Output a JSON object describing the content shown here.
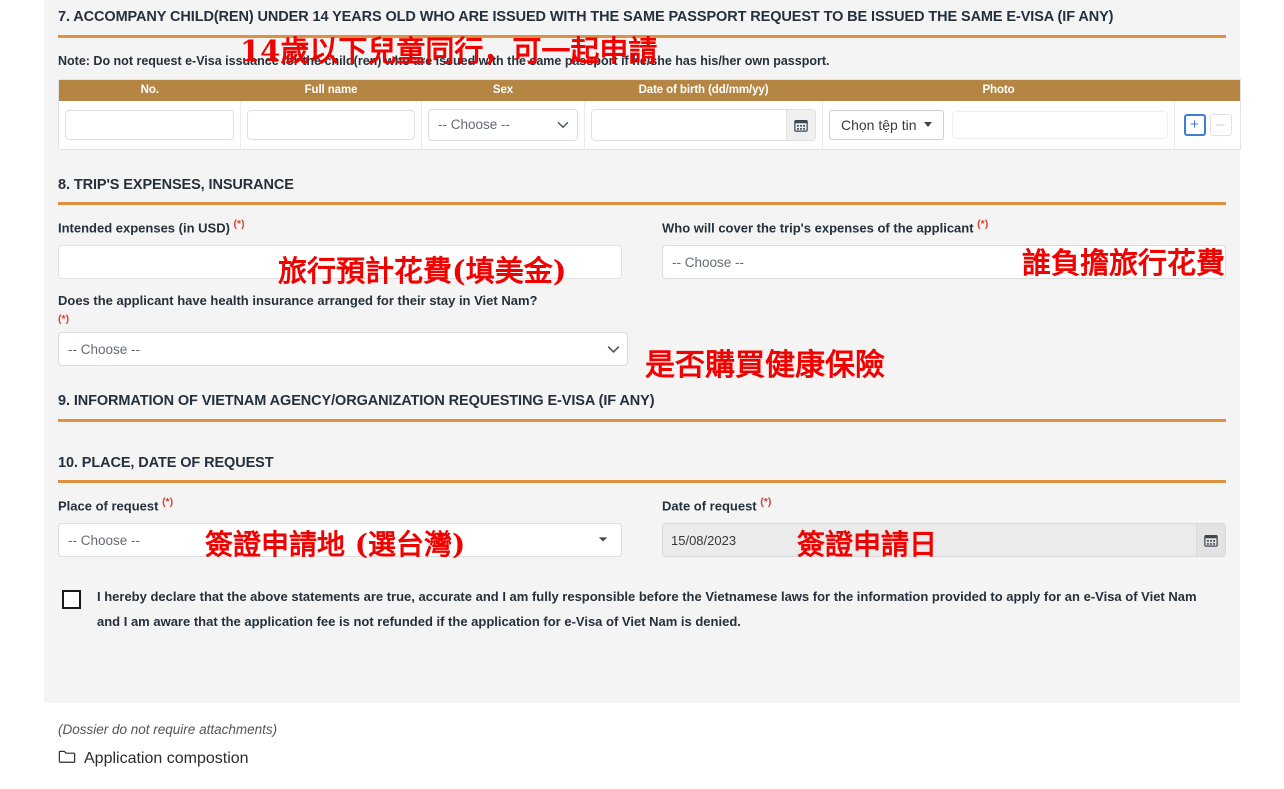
{
  "section7": {
    "title": "7. ACCOMPANY CHILD(REN) UNDER 14 YEARS OLD WHO ARE ISSUED WITH THE SAME PASSPORT REQUEST TO BE ISSUED THE SAME E-VISA (IF ANY)",
    "annotation": "14歲以下兒童同行，可一起申請",
    "note": "Note: Do not request e-Visa issuance for the child(ren) who are issued with the same passport if he/she has his/her own passport.",
    "table": {
      "headers": [
        "No.",
        "Full name",
        "Sex",
        "Date of birth (dd/mm/yy)",
        "Photo",
        ""
      ],
      "rows": [
        {
          "no": "",
          "full_name": "",
          "sex": "-- Choose --",
          "dob": "",
          "photo_button": "Chọn tệp tin",
          "photo_value": "",
          "add_label": "+",
          "remove_label": "–"
        }
      ]
    }
  },
  "section8": {
    "title": "8. TRIP'S EXPENSES, INSURANCE",
    "intended_expenses": {
      "label": "Intended expenses (in USD)",
      "required": "(*)",
      "value": "",
      "annotation": "旅行預計花費(填美金)"
    },
    "who_covers": {
      "label": "Who will cover the trip's expenses of the applicant",
      "required": "(*)",
      "value": "-- Choose --",
      "annotation": "誰負擔旅行花費"
    },
    "health_insurance": {
      "label": "Does the applicant have health insurance arranged for their stay in Viet Nam?",
      "required": "(*)",
      "value": "-- Choose --",
      "annotation": "是否購買健康保險"
    }
  },
  "section9": {
    "title": "9. INFORMATION OF VIETNAM AGENCY/ORGANIZATION REQUESTING E-VISA (IF ANY)"
  },
  "section10": {
    "title": "10. PLACE, DATE OF REQUEST",
    "place_of_request": {
      "label": "Place of request",
      "required": "(*)",
      "value": "-- Choose --",
      "annotation": "簽證申請地 (選台灣)"
    },
    "date_of_request": {
      "label": "Date of request",
      "required": "(*)",
      "value": "15/08/2023",
      "annotation": "簽證申請日"
    }
  },
  "declaration": {
    "text": "I hereby declare that the above statements are true, accurate and I am fully responsible before the Vietnamese laws for the information provided to apply for an e-Visa of Viet Nam and I am aware that the application fee is not refunded if the application for e-Visa of Viet Nam is denied.",
    "checked": false
  },
  "footer": {
    "dossier_note": "(Dossier do not require attachments)",
    "application_composition": "Application compostion",
    "folder_icon": "folder-icon"
  },
  "colors": {
    "divider_orange": "#e0913f",
    "table_header_brown": "#b58543",
    "annotation_red": "#f00200",
    "panel_bg": "#f4f4f4",
    "accent_blue": "#3d7fd4"
  }
}
